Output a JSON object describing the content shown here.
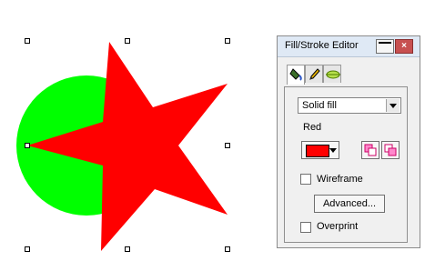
{
  "colors": {
    "circle_fill": "#00ff00",
    "star_fill": "#ff0000",
    "close_button": "#c75050"
  },
  "panel": {
    "title": "Fill/Stroke Editor",
    "close_label": "×",
    "tabs": [
      {
        "name": "fill-bucket-icon",
        "active": true
      },
      {
        "name": "pencil-icon",
        "active": false
      },
      {
        "name": "stroke-style-icon",
        "active": false
      }
    ],
    "fill_type": "Solid fill",
    "color_name": "Red",
    "wireframe_label": "Wireframe",
    "wireframe_checked": false,
    "advanced_label": "Advanced...",
    "overprint_label": "Overprint",
    "overprint_checked": false
  }
}
